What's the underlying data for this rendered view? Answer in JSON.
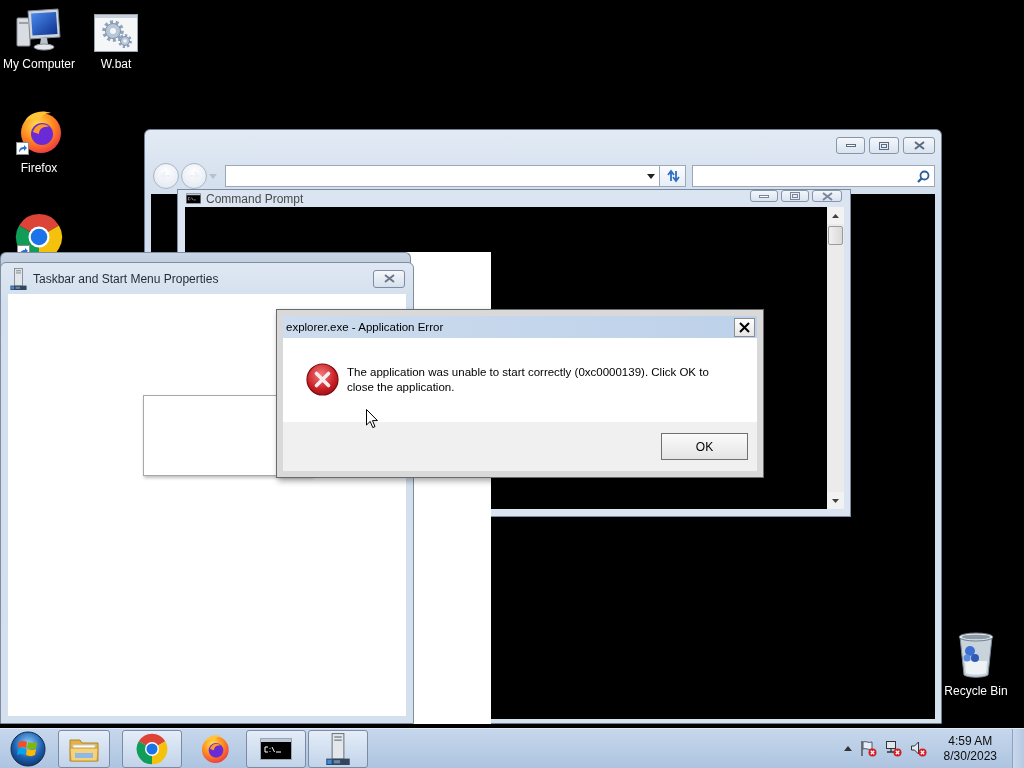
{
  "desktop_icons": [
    {
      "kind": "computer",
      "label": "My Computer"
    },
    {
      "kind": "batch",
      "label": "W.bat"
    },
    {
      "kind": "firefox",
      "label": "Firefox"
    },
    {
      "kind": "chrome"
    },
    {
      "kind": "recycle_bin",
      "label": "Recycle Bin"
    }
  ],
  "console_window": {
    "title": "Command Prompt"
  },
  "properties_window": {
    "title": "Taskbar and Start Menu Properties"
  },
  "error_dialog": {
    "title": "explorer.exe - Application Error",
    "message": "The application was unable to start correctly (0xc0000139). Click OK to close the application.",
    "buttons": [
      "OK"
    ]
  },
  "taskbar": {
    "buttons": [
      {
        "kind": "explorer",
        "running": true
      },
      {
        "kind": "chrome",
        "running": true
      },
      {
        "kind": "firefox",
        "running": false
      },
      {
        "kind": "cmd",
        "running": true
      },
      {
        "kind": "properties",
        "running": true
      }
    ],
    "clock": {
      "time": "4:59 AM",
      "date": "8/30/2023"
    }
  }
}
